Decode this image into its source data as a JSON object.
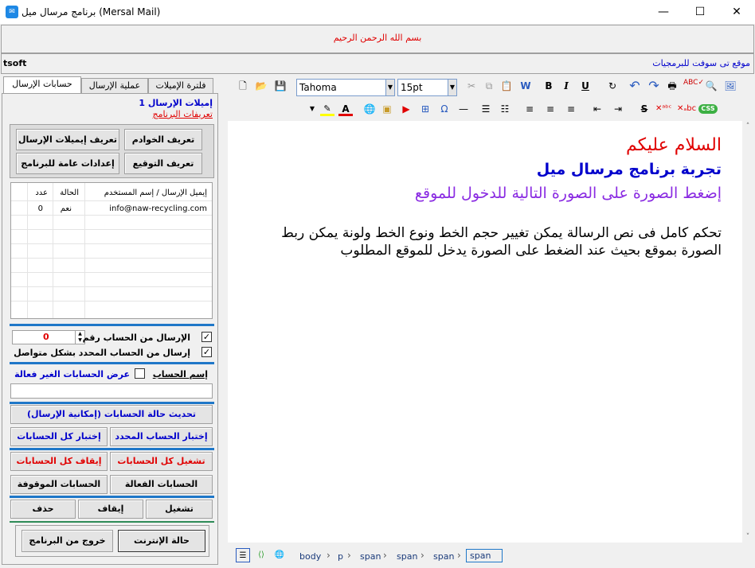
{
  "window": {
    "title": "برنامج مرسال ميل (Mersal Mail)",
    "minimize": "—",
    "maximize": "☐",
    "close": "✕"
  },
  "banner": "بسم الله الرحمن الرحيم",
  "infobar": {
    "left": "tsoft",
    "right": "موقع تى سوفت للبرمجيات"
  },
  "tabs": [
    "حسابات الإرسال",
    "عملية الإرسال",
    "فلترة الإميلات"
  ],
  "left": {
    "link1": "إميلات الإرسال 1",
    "link2": "تعريفات البرنامج",
    "buttons": {
      "define_servers": "تعريف الخوادم",
      "define_send_emails": "تعريف إيميلات الإرسال",
      "define_signature": "تعريف التوقيع",
      "general_settings": "إعدادات عامة للبرنامج"
    },
    "grid": {
      "columns": [
        "إيميل الإرسال / إسم المستخدم",
        "الحالة",
        "عدد"
      ],
      "rows": [
        {
          "email": "info@naw-recycling.com",
          "status": "نعم",
          "count": "0"
        }
      ]
    },
    "send_from_account_label": "الإرسال من الحساب رقم",
    "send_from_account_value": "0",
    "send_continuous_label": "إرسال من الحساب المحدد بشكل متواصل",
    "account_name_label": "إسم الحساب",
    "show_inactive_label": "عرض الحسابات الغير فعالة",
    "account_name_value": "",
    "actions": {
      "update_status": "تحديث حالة الحسابات (إمكانية الإرسال)",
      "test_selected": "إختبار الحساب المحدد",
      "test_all": "إختبار كل الحسابات",
      "run_all": "تشغيل كل الحسابات",
      "stop_all": "إيقاف كل الحسابات",
      "active_accounts": "الحسابات الفعالة",
      "stopped_accounts": "الحسابات الموقوفة",
      "run": "تشغيل",
      "stop": "إيقاف",
      "delete": "حذف",
      "internet_status": "حالة الإنترنت",
      "exit": "خروج من البرنامج"
    }
  },
  "toolbar": {
    "font": "Tahoma",
    "size": "15pt"
  },
  "content": {
    "line1": "السلام عليكم",
    "line2": "تجربة برنامج مرسال ميل",
    "line3": "إضغط الصورة على الصورة التالية للدخول للموقع",
    "para": "تحكم كامل فى نص الرسالة يمكن تغيير حجم الخط ونوع الخط ولونة يمكن ربط الصورة بموقع بحيث عند الضغط على الصورة يدخل للموقع المطلوب"
  },
  "breadcrumb": [
    "body",
    "p",
    "span",
    "span",
    "span",
    "span"
  ],
  "colors": {
    "red": "#e00000",
    "blue": "#0000cc",
    "purple": "#8a2be2"
  }
}
